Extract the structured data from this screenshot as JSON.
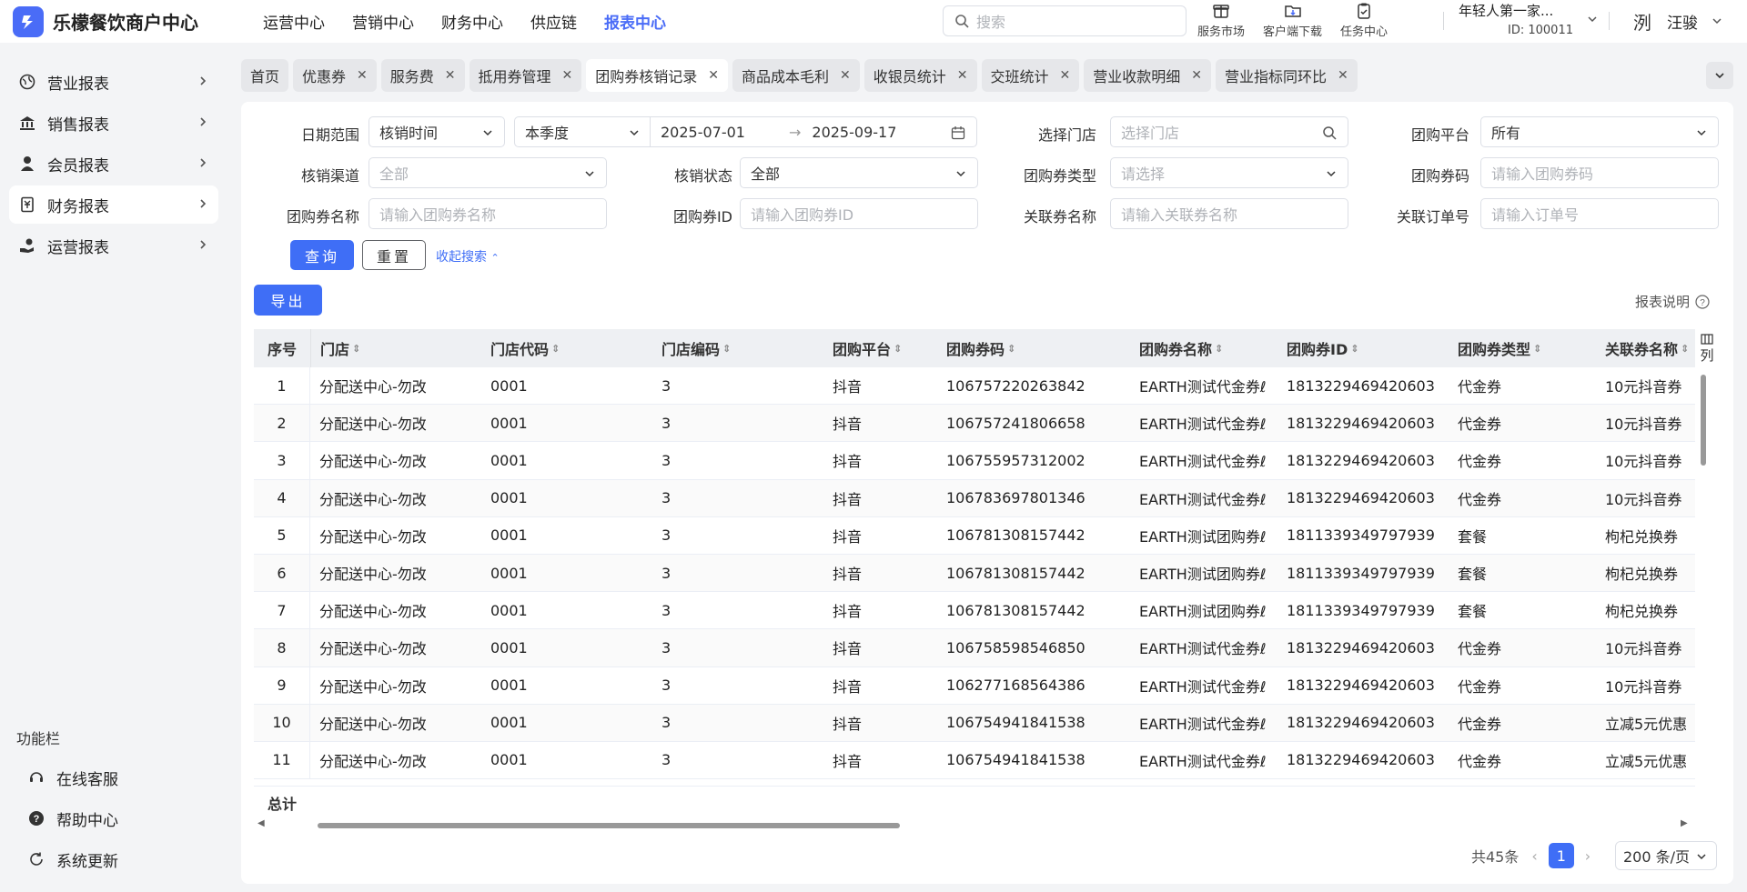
{
  "app": {
    "name": "乐檬餐饮商户中心"
  },
  "topnav": [
    {
      "label": "运营中心",
      "active": false
    },
    {
      "label": "营销中心",
      "active": false
    },
    {
      "label": "财务中心",
      "active": false
    },
    {
      "label": "供应链",
      "active": false
    },
    {
      "label": "报表中心",
      "active": true
    }
  ],
  "search": {
    "placeholder": "搜索"
  },
  "top_icons": [
    {
      "label": "服务市场",
      "icon": "gift-box-icon"
    },
    {
      "label": "客户端下载",
      "icon": "folder-download-icon"
    },
    {
      "label": "任务中心",
      "icon": "clipboard-icon"
    }
  ],
  "shop": {
    "name": "年轻人第一家...",
    "id": "ID: 100011"
  },
  "user": {
    "name": "汪骏",
    "avatar": "洌"
  },
  "sidebar": {
    "items": [
      {
        "label": "营业报表",
        "icon": "globe-icon",
        "active": false
      },
      {
        "label": "销售报表",
        "icon": "bank-icon",
        "active": false
      },
      {
        "label": "会员报表",
        "icon": "person-icon",
        "active": false
      },
      {
        "label": "财务报表",
        "icon": "ledger-icon",
        "active": true
      },
      {
        "label": "运营报表",
        "icon": "hand-coin-icon",
        "active": false
      }
    ],
    "func_title": "功能栏",
    "func_items": [
      {
        "label": "在线客服",
        "icon": "headset-icon"
      },
      {
        "label": "帮助中心",
        "icon": "help-icon"
      },
      {
        "label": "系统更新",
        "icon": "refresh-icon"
      }
    ]
  },
  "tabs": [
    {
      "label": "首页",
      "closable": false,
      "active": false
    },
    {
      "label": "优惠券",
      "closable": true,
      "active": false
    },
    {
      "label": "服务费",
      "closable": true,
      "active": false
    },
    {
      "label": "抵用券管理",
      "closable": true,
      "active": false
    },
    {
      "label": "团购券核销记录",
      "closable": true,
      "active": true
    },
    {
      "label": "商品成本毛利",
      "closable": true,
      "active": false
    },
    {
      "label": "收银员统计",
      "closable": true,
      "active": false
    },
    {
      "label": "交班统计",
      "closable": true,
      "active": false
    },
    {
      "label": "营业收款明细",
      "closable": true,
      "active": false
    },
    {
      "label": "营业指标同环比",
      "closable": true,
      "active": false
    }
  ],
  "filters": {
    "date_range_label": "日期范围",
    "date_type": "核销时间",
    "period": "本季度",
    "date_start": "2025-07-01",
    "date_end": "2025-09-17",
    "store_label": "选择门店",
    "store_placeholder": "选择门店",
    "platform_label": "团购平台",
    "platform_value": "所有",
    "channel_label": "核销渠道",
    "channel_placeholder": "全部",
    "status_label": "核销状态",
    "status_value": "全部",
    "coupon_type_label": "团购券类型",
    "coupon_type_placeholder": "请选择",
    "coupon_code_label": "团购券码",
    "coupon_code_placeholder": "请输入团购券码",
    "coupon_name_label": "团购券名称",
    "coupon_name_placeholder": "请输入团购券名称",
    "coupon_id_label": "团购券ID",
    "coupon_id_placeholder": "请输入团购券ID",
    "related_name_label": "关联券名称",
    "related_name_placeholder": "请输入关联券名称",
    "order_label": "关联订单号",
    "order_placeholder": "请输入订单号",
    "query_btn": "查询",
    "reset_btn": "重置",
    "collapse_link": "收起搜索"
  },
  "export_btn": "导出",
  "report_desc": "报表说明",
  "table": {
    "columns": [
      "序号",
      "门店",
      "门店代码",
      "门店编码",
      "团购平台",
      "团购券码",
      "团购券名称",
      "团购券ID",
      "团购券类型",
      "关联券名称"
    ],
    "column_settings": "列",
    "rows": [
      [
        "1",
        "分配送中心-勿改",
        "0001",
        "3",
        "抖音",
        "106757220263842",
        "EARTH测试代金券ℓ",
        "1813229469420603",
        "代金券",
        "10元抖音券"
      ],
      [
        "2",
        "分配送中心-勿改",
        "0001",
        "3",
        "抖音",
        "106757241806658",
        "EARTH测试代金券ℓ",
        "1813229469420603",
        "代金券",
        "10元抖音券"
      ],
      [
        "3",
        "分配送中心-勿改",
        "0001",
        "3",
        "抖音",
        "106755957312002",
        "EARTH测试代金券ℓ",
        "1813229469420603",
        "代金券",
        "10元抖音券"
      ],
      [
        "4",
        "分配送中心-勿改",
        "0001",
        "3",
        "抖音",
        "106783697801346",
        "EARTH测试代金券ℓ",
        "1813229469420603",
        "代金券",
        "10元抖音券"
      ],
      [
        "5",
        "分配送中心-勿改",
        "0001",
        "3",
        "抖音",
        "106781308157442",
        "EARTH测试团购券ℓ",
        "1811339349797939",
        "套餐",
        "枸杞兑换券"
      ],
      [
        "6",
        "分配送中心-勿改",
        "0001",
        "3",
        "抖音",
        "106781308157442",
        "EARTH测试团购券ℓ",
        "1811339349797939",
        "套餐",
        "枸杞兑换券"
      ],
      [
        "7",
        "分配送中心-勿改",
        "0001",
        "3",
        "抖音",
        "106781308157442",
        "EARTH测试团购券ℓ",
        "1811339349797939",
        "套餐",
        "枸杞兑换券"
      ],
      [
        "8",
        "分配送中心-勿改",
        "0001",
        "3",
        "抖音",
        "106758598546850",
        "EARTH测试代金券ℓ",
        "1813229469420603",
        "代金券",
        "10元抖音券"
      ],
      [
        "9",
        "分配送中心-勿改",
        "0001",
        "3",
        "抖音",
        "106277168564386",
        "EARTH测试代金券ℓ",
        "1813229469420603",
        "代金券",
        "10元抖音券"
      ],
      [
        "10",
        "分配送中心-勿改",
        "0001",
        "3",
        "抖音",
        "106754941841538",
        "EARTH测试代金券ℓ",
        "1813229469420603",
        "代金券",
        "立减5元优惠"
      ],
      [
        "11",
        "分配送中心-勿改",
        "0001",
        "3",
        "抖音",
        "106754941841538",
        "EARTH测试代金券ℓ",
        "1813229469420603",
        "代金券",
        "立减5元优惠"
      ]
    ],
    "total_label": "总计"
  },
  "pagination": {
    "total": "共45条",
    "current": "1",
    "page_size": "200 条/页"
  },
  "colors": {
    "accent": "#3f6ef6",
    "bg": "#f3f4f6"
  }
}
